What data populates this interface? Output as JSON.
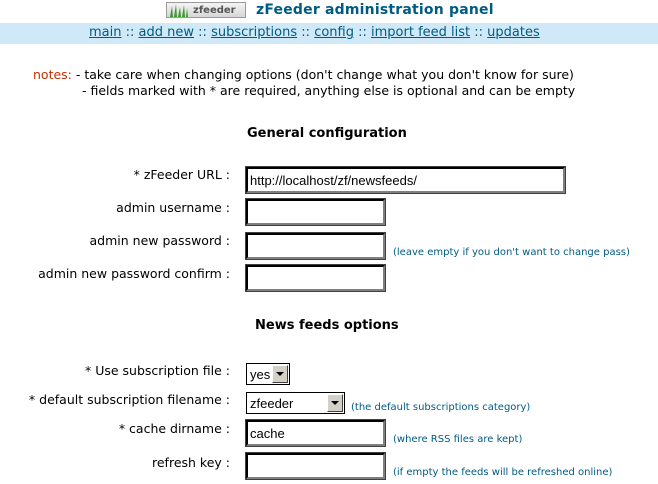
{
  "header": {
    "logo_text": "zfeeder",
    "title": "zFeeder administration panel"
  },
  "nav": {
    "items": [
      "main",
      "add new",
      "subscriptions",
      "config",
      "import feed list",
      "updates"
    ],
    "separator": "::"
  },
  "notes": {
    "label": "notes:",
    "line1": "- take care when changing options (don't change what you don't know for sure)",
    "line2": "- fields marked with * are required, anything else is optional and can be empty"
  },
  "general": {
    "heading": "General configuration",
    "zfeeder_url_label": "* zFeeder URL :",
    "zfeeder_url_value": "http://localhost/zf/newsfeeds/",
    "admin_username_label": "admin username :",
    "admin_username_value": "",
    "admin_password_label": "admin new password :",
    "admin_password_value": "",
    "admin_password_hint": "(leave empty if you don't want to change pass)",
    "admin_password_confirm_label": "admin new password confirm :",
    "admin_password_confirm_value": ""
  },
  "news": {
    "heading": "News feeds options",
    "use_subscription_label": "* Use subscription file :",
    "use_subscription_value": "yes",
    "default_sub_label": "* default subscription filename :",
    "default_sub_value": "zfeeder",
    "default_sub_hint": "(the default subscriptions category)",
    "cache_label": "* cache dirname :",
    "cache_value": "cache",
    "cache_hint": "(where RSS files are kept)",
    "refresh_label": "refresh key :",
    "refresh_value": "",
    "refresh_hint": "(if empty the feeds will be refreshed online)"
  },
  "colors": {
    "accent": "#005b82",
    "nav_bg": "#cfe9f8",
    "notes_label": "#c03000"
  }
}
